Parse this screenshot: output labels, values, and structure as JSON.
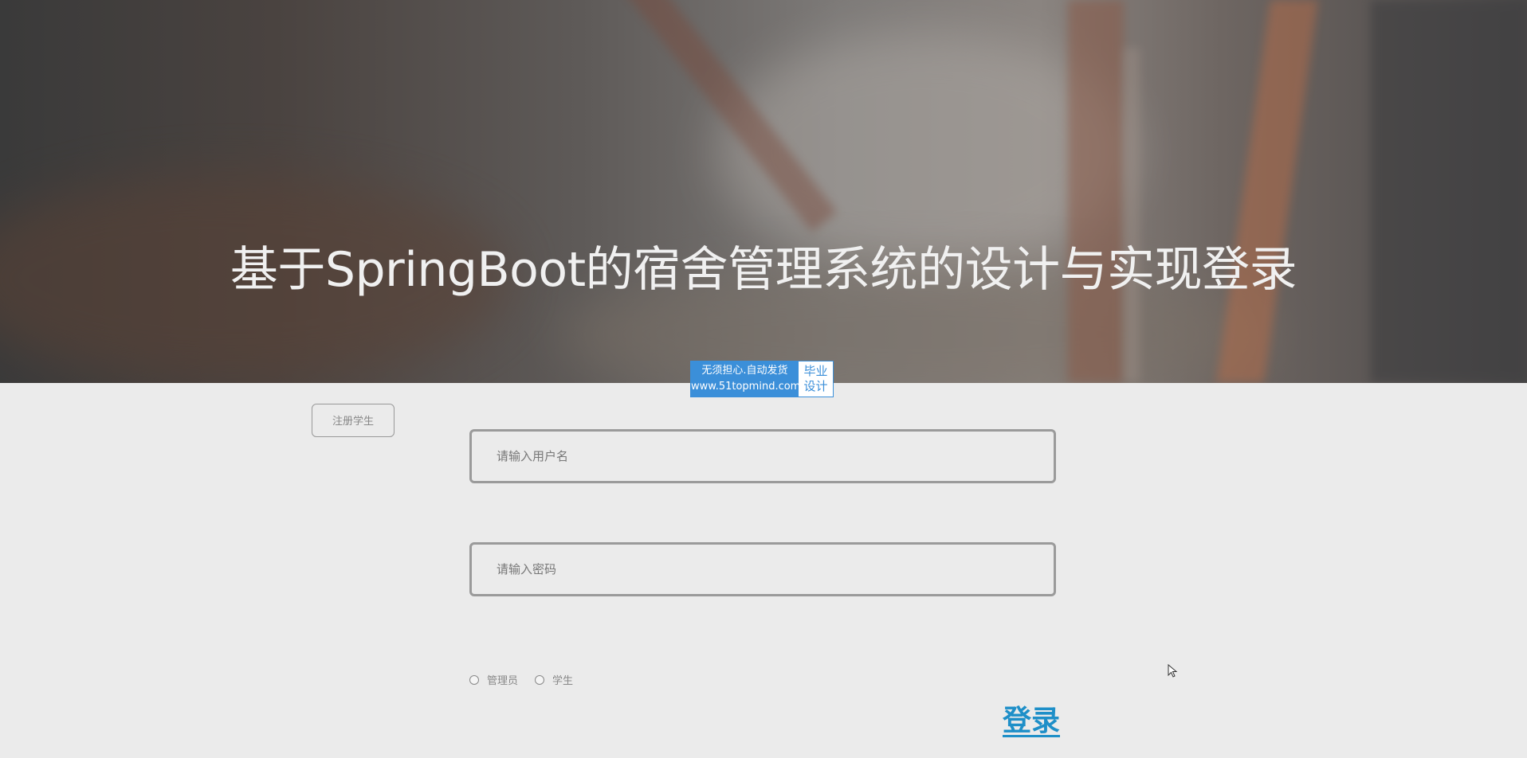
{
  "hero": {
    "title": "基于SpringBoot的宿舍管理系统的设计与实现登录"
  },
  "ad_badge": {
    "line1": "无须担心.自动发货",
    "line2": "www.51topmind.com",
    "right_line1": "毕业",
    "right_line2": "设计"
  },
  "register_button": {
    "label": "注册学生"
  },
  "username": {
    "placeholder": "请输入用户名",
    "value": ""
  },
  "password": {
    "placeholder": "请输入密码",
    "value": ""
  },
  "roles": [
    {
      "label": "管理员",
      "selected": false
    },
    {
      "label": "学生",
      "selected": false
    }
  ],
  "login_button": {
    "label": "登录"
  },
  "colors": {
    "accent": "#1e8fc8",
    "page_background": "#ebebeb",
    "badge_blue": "#3b8fd9"
  }
}
